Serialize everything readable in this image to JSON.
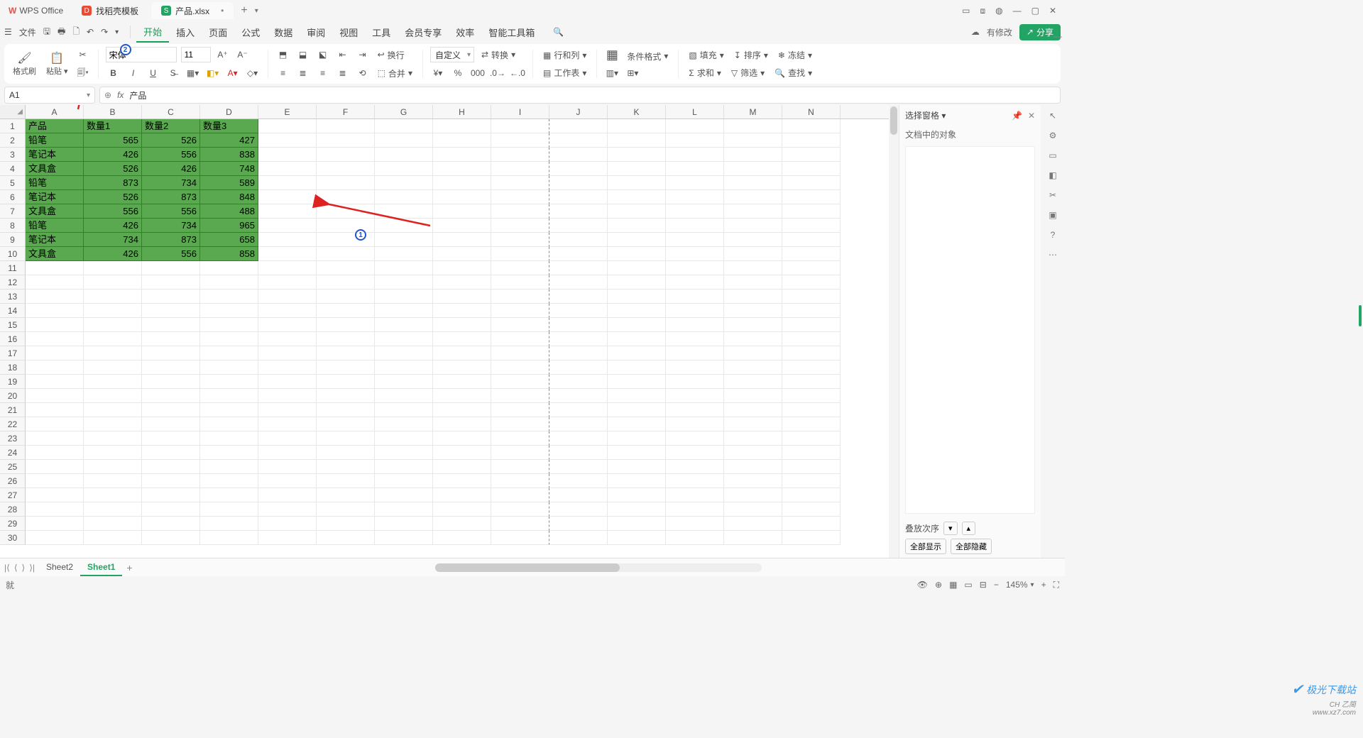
{
  "titlebar": {
    "app": "WPS Office",
    "tab_template": "找稻壳模板",
    "doc_name": "产品.xlsx",
    "dirty": "•",
    "add": "+",
    "ctrl_min": "—",
    "ctrl_max": "▢",
    "ctrl_close": "✕"
  },
  "menubar": {
    "file": "文件",
    "items": [
      "开始",
      "插入",
      "页面",
      "公式",
      "数据",
      "审阅",
      "视图",
      "工具",
      "会员专享",
      "效率",
      "智能工具箱"
    ],
    "active_index": 0,
    "modified": "有修改",
    "share": "分享"
  },
  "ribbon": {
    "format_painter": "格式刷",
    "paste": "粘贴",
    "font_name": "宋体",
    "font_size": "11",
    "wrap": "换行",
    "merge": "合并",
    "number_format": "自定义",
    "convert": "转换",
    "rowcol": "行和列",
    "worksheet": "工作表",
    "cond_fmt": "条件格式",
    "fill": "填充",
    "sort": "排序",
    "freeze": "冻结",
    "sum": "求和",
    "filter": "筛选",
    "find": "查找"
  },
  "namebox": {
    "ref": "A1"
  },
  "formula": {
    "fx": "fx",
    "value": "产品"
  },
  "columns": [
    "A",
    "B",
    "C",
    "D",
    "E",
    "F",
    "G",
    "H",
    "I",
    "J",
    "K",
    "L",
    "M",
    "N"
  ],
  "row_count": 30,
  "table": {
    "headers": [
      "产品",
      "数量1",
      "数量2",
      "数量3"
    ],
    "rows": [
      [
        "铅笔",
        565,
        526,
        427
      ],
      [
        "笔记本",
        426,
        556,
        838
      ],
      [
        "文具盒",
        526,
        426,
        748
      ],
      [
        "铅笔",
        873,
        734,
        589
      ],
      [
        "笔记本",
        526,
        873,
        848
      ],
      [
        "文具盒",
        556,
        556,
        488
      ],
      [
        "铅笔",
        426,
        734,
        965
      ],
      [
        "笔记本",
        734,
        873,
        658
      ],
      [
        "文具盒",
        426,
        556,
        858
      ]
    ]
  },
  "annotations": {
    "badge1": "1",
    "badge2": "2"
  },
  "panel": {
    "title": "选择窗格",
    "subtitle": "文档中的对象",
    "stack_order": "叠放次序",
    "show_all": "全部显示",
    "hide_all": "全部隐藏"
  },
  "sheets": {
    "names": [
      "Sheet2",
      "Sheet1"
    ],
    "active_index": 1
  },
  "status": {
    "ready": "就",
    "zoom": "145%",
    "ime": "CH 乙简"
  },
  "watermark": {
    "brand": "极光下载站",
    "url": "www.xz7.com"
  }
}
